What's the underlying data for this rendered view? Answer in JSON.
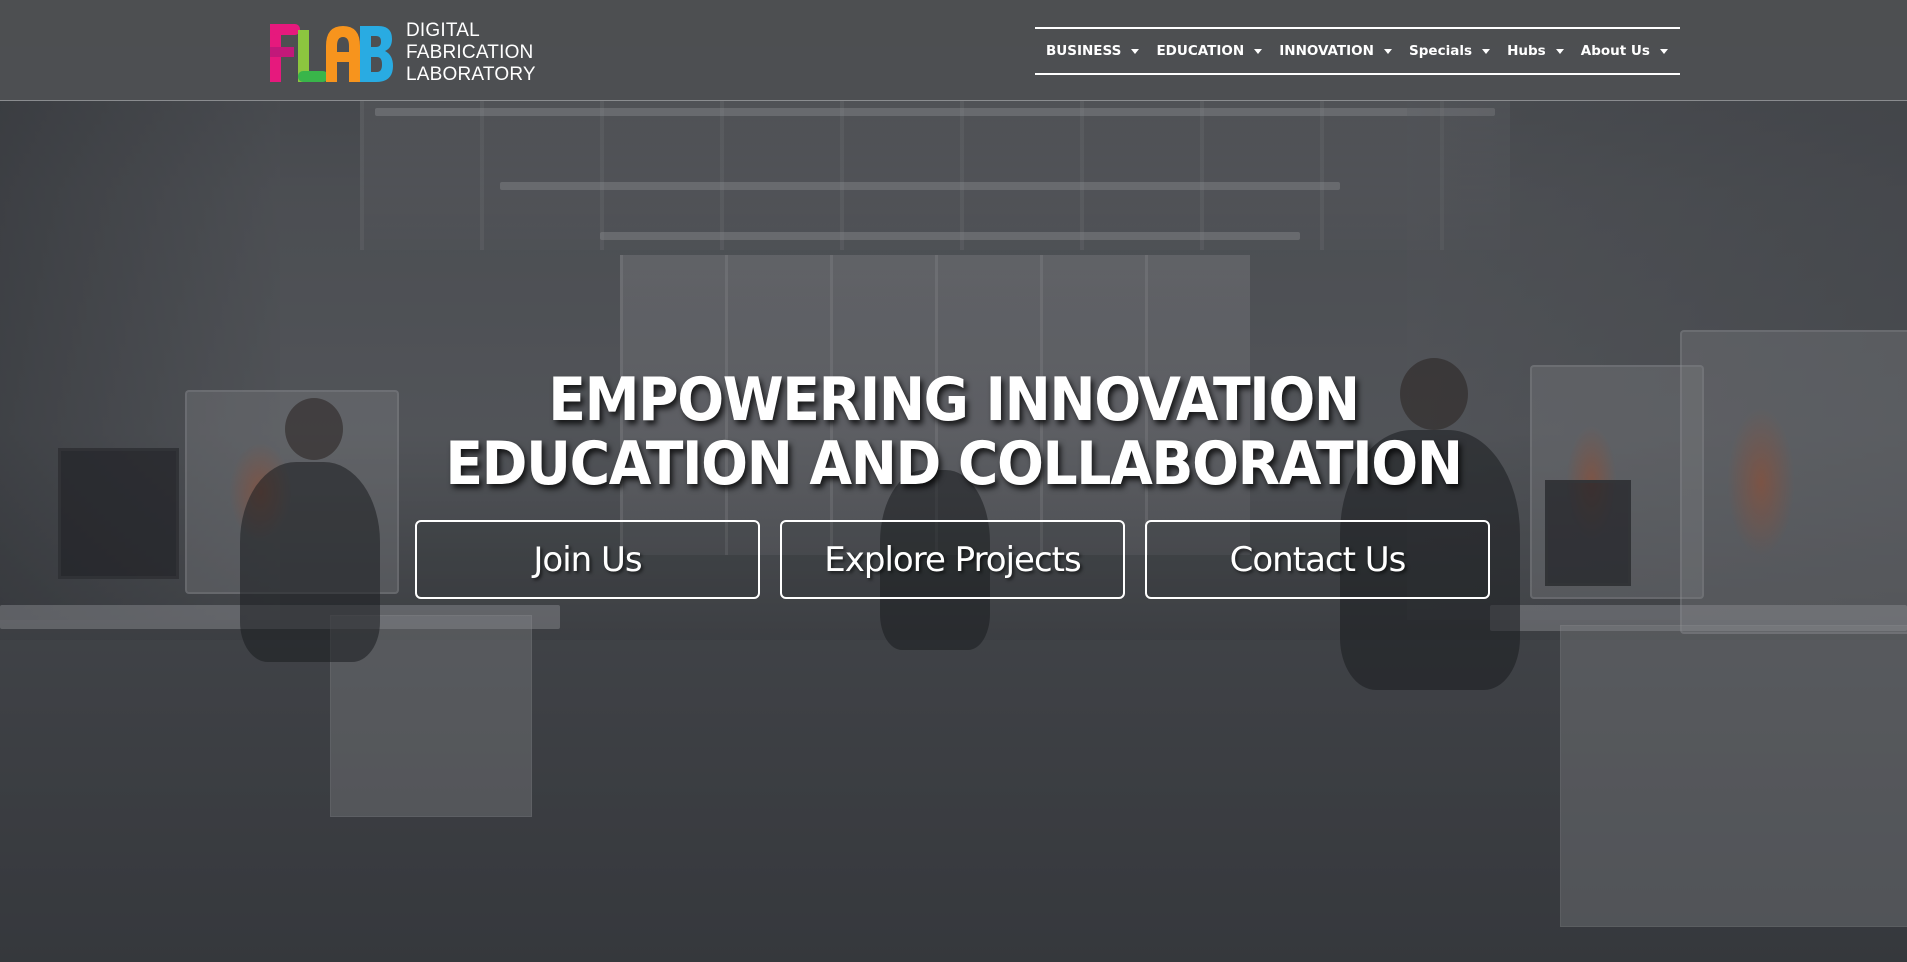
{
  "brand": {
    "logo_mark": "FLAB",
    "logo_lines": [
      "DIGITAL",
      "FABRICATION",
      "LABORATORY"
    ],
    "logo_colors": [
      "#e6197d",
      "#8cc63f",
      "#f7941d",
      "#29abe2"
    ]
  },
  "nav": {
    "items": [
      {
        "label": "BUSINESS",
        "icon": "caret-down-icon"
      },
      {
        "label": "EDUCATION",
        "icon": "caret-down-icon"
      },
      {
        "label": "INNOVATION",
        "icon": "caret-down-icon"
      },
      {
        "label": "Specials",
        "icon": "caret-down-icon"
      },
      {
        "label": "Hubs",
        "icon": "caret-down-icon"
      },
      {
        "label": "About Us",
        "icon": "caret-down-icon"
      }
    ]
  },
  "hero": {
    "title_line1": "EMPOWERING INNOVATION",
    "title_line2": "EDUCATION AND COLLABORATION",
    "buttons": [
      {
        "label": "Join Us"
      },
      {
        "label": "Explore Projects"
      },
      {
        "label": "Contact Us"
      }
    ]
  }
}
